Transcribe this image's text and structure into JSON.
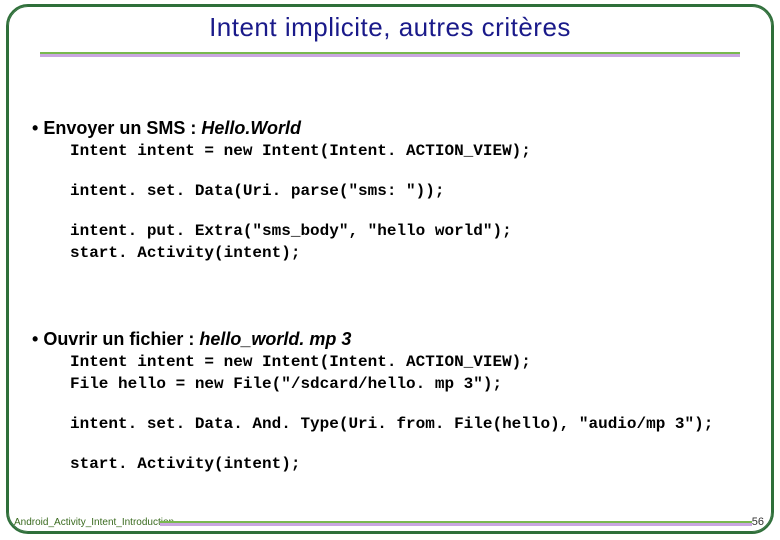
{
  "title": "Intent implicite, autres critères",
  "bullets": [
    {
      "text": "Envoyer un SMS : ",
      "suffix": "Hello.World",
      "code": [
        "Intent intent = new Intent(Intent. ACTION_VIEW);",
        "",
        "intent. set. Data(Uri. parse(\"sms: \"));",
        "",
        "intent. put. Extra(\"sms_body\", \"hello world\");",
        "start. Activity(intent);"
      ]
    },
    {
      "text": "Ouvrir un fichier : ",
      "suffix": "hello_world. mp 3",
      "code": [
        "Intent intent = new Intent(Intent. ACTION_VIEW);",
        "File hello = new File(\"/sdcard/hello. mp 3\");",
        "",
        "intent. set. Data. And. Type(Uri. from. File(hello), \"audio/mp 3\");",
        "",
        "start. Activity(intent);"
      ]
    }
  ],
  "footer": "Android_Activity_Intent_Introduction",
  "page": "56"
}
